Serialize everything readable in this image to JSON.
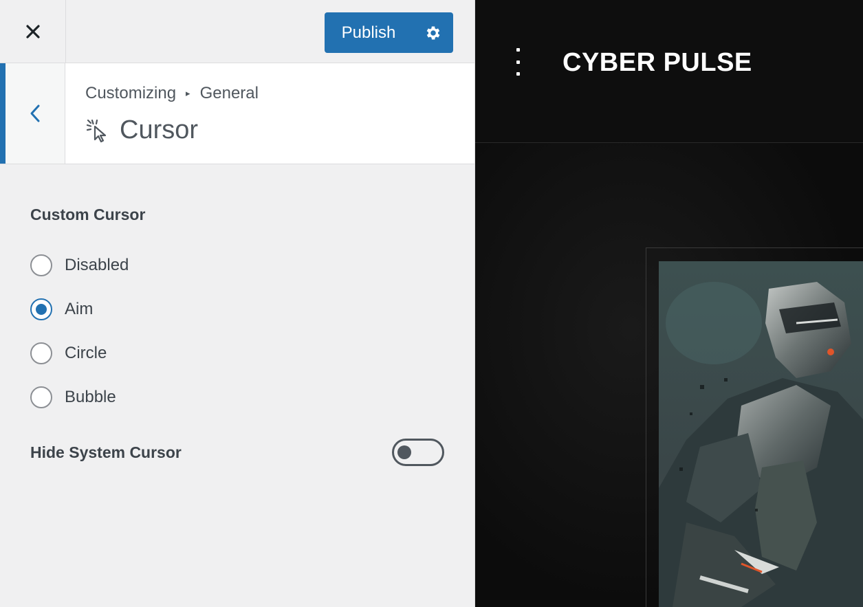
{
  "header": {
    "close_icon": "close-icon",
    "publish_label": "Publish",
    "settings_icon": "gear-icon"
  },
  "section": {
    "breadcrumb": [
      "Customizing",
      "General"
    ],
    "breadcrumb_separator": "▸",
    "title": "Cursor",
    "title_icon": "cursor-click-icon",
    "back_icon": "chevron-left-icon"
  },
  "controls": {
    "custom_cursor_label": "Custom Cursor",
    "options": [
      {
        "label": "Disabled",
        "checked": false
      },
      {
        "label": "Aim",
        "checked": true
      },
      {
        "label": "Circle",
        "checked": false
      },
      {
        "label": "Bubble",
        "checked": false
      }
    ],
    "hide_system_cursor_label": "Hide System Cursor",
    "hide_system_cursor_on": false
  },
  "preview": {
    "site_title": "CYBER PULSE",
    "menu_icon": "vertical-dots-icon",
    "hero_image": "robot-illustration"
  },
  "colors": {
    "accent": "#2271b1",
    "panel_bg": "#f0f0f1",
    "preview_bg": "#0d0d0d"
  }
}
